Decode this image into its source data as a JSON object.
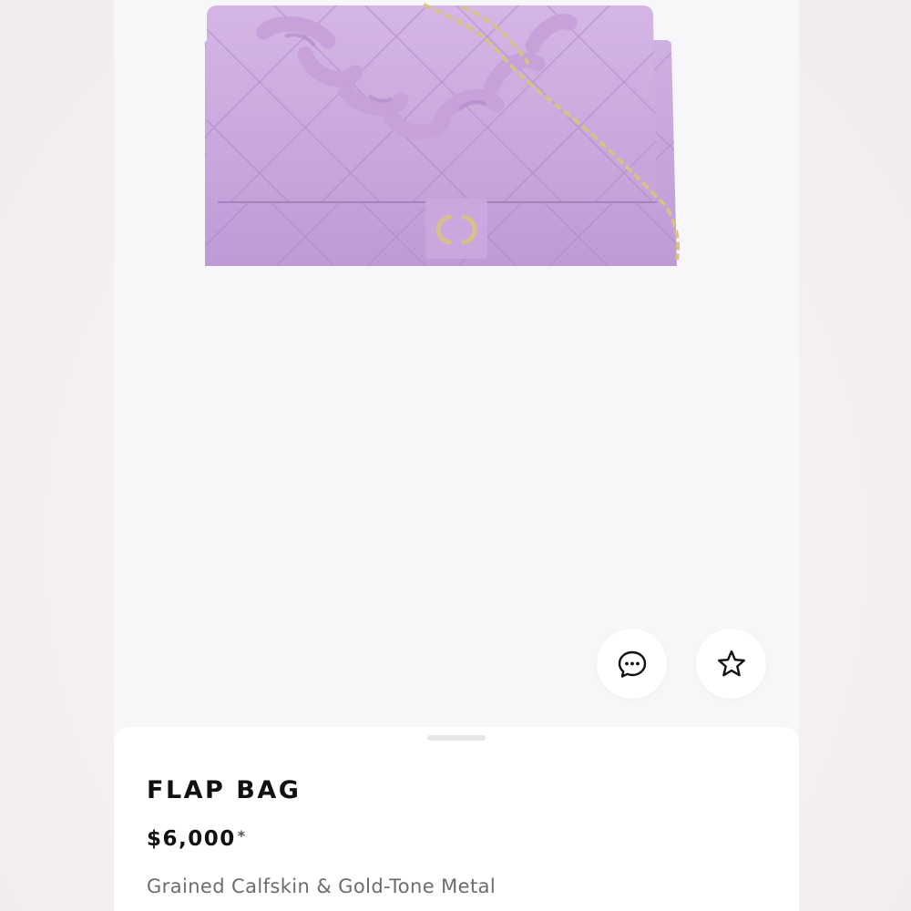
{
  "product": {
    "title": "FLAP BAG",
    "price": "$6,000",
    "price_note": "*",
    "material": "Grained Calfskin & Gold-Tone Metal",
    "image_alt": "Lilac quilted flap bag with chunky chain strap"
  },
  "actions": {
    "chat_icon": "chat-bubble-icon",
    "favorite_icon": "star-outline-icon"
  },
  "colors": {
    "bag": "#c9a8dd",
    "hardware": "#d8c08a",
    "text_primary": "#111111",
    "text_secondary": "#6c6c6c"
  }
}
